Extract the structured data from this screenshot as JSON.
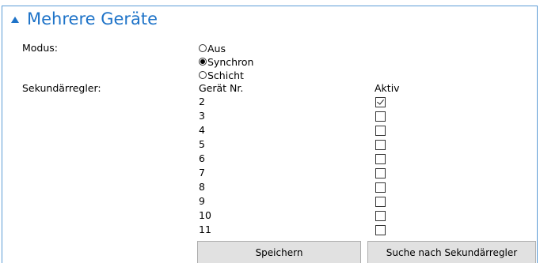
{
  "section": {
    "title": "Mehrere Geräte"
  },
  "modus": {
    "label": "Modus:",
    "options": [
      {
        "label": "Aus",
        "checked": false
      },
      {
        "label": "Synchron",
        "checked": true
      },
      {
        "label": "Schicht",
        "checked": false
      }
    ]
  },
  "secondary": {
    "label": "Sekundärregler:",
    "col_device": "Gerät Nr.",
    "col_active": "Aktiv",
    "rows": [
      {
        "device": "2",
        "active": true
      },
      {
        "device": "3",
        "active": false
      },
      {
        "device": "4",
        "active": false
      },
      {
        "device": "5",
        "active": false
      },
      {
        "device": "6",
        "active": false
      },
      {
        "device": "7",
        "active": false
      },
      {
        "device": "8",
        "active": false
      },
      {
        "device": "9",
        "active": false
      },
      {
        "device": "10",
        "active": false
      },
      {
        "device": "11",
        "active": false
      }
    ]
  },
  "buttons": {
    "save": "Speichern",
    "search": "Suche nach Sekundärregler"
  },
  "colors": {
    "accent": "#1e73c8",
    "border": "#5b9bd5",
    "button_bg": "#e1e1e1"
  }
}
